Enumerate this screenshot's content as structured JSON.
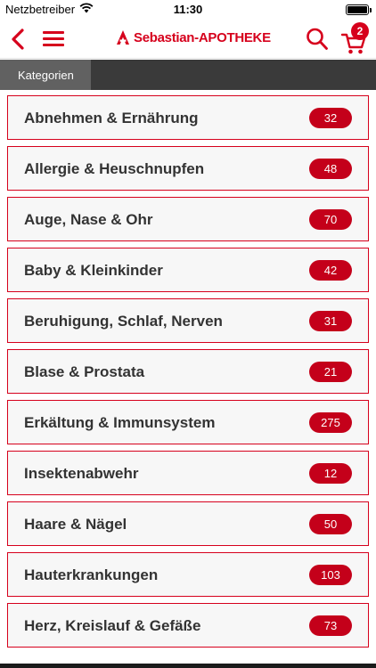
{
  "status_bar": {
    "carrier": "Netzbetreiber",
    "time": "11:30",
    "icons": [
      "wifi-icon",
      "battery-icon"
    ]
  },
  "nav": {
    "brand": "Sebastian-APOTHEKE",
    "cart_count": "2",
    "icons": [
      "back-chevron-icon",
      "menu-icon",
      "apotheke-a-logo-icon",
      "search-icon",
      "cart-icon"
    ],
    "accent_color": "#d6001c"
  },
  "section": {
    "title": "Kategorien"
  },
  "categories": [
    {
      "name": "Abnehmen & Ernährung",
      "count": "32"
    },
    {
      "name": "Allergie & Heuschnupfen",
      "count": "48"
    },
    {
      "name": "Auge, Nase & Ohr",
      "count": "70"
    },
    {
      "name": "Baby & Kleinkinder",
      "count": "42"
    },
    {
      "name": "Beruhigung, Schlaf, Nerven",
      "count": "31"
    },
    {
      "name": "Blase & Prostata",
      "count": "21"
    },
    {
      "name": "Erkältung & Immunsystem",
      "count": "275"
    },
    {
      "name": "Insektenabwehr",
      "count": "12"
    },
    {
      "name": "Haare & Nägel",
      "count": "50"
    },
    {
      "name": "Hauterkrankungen",
      "count": "103"
    },
    {
      "name": "Herz, Kreislauf & Gefäße",
      "count": "73"
    }
  ]
}
